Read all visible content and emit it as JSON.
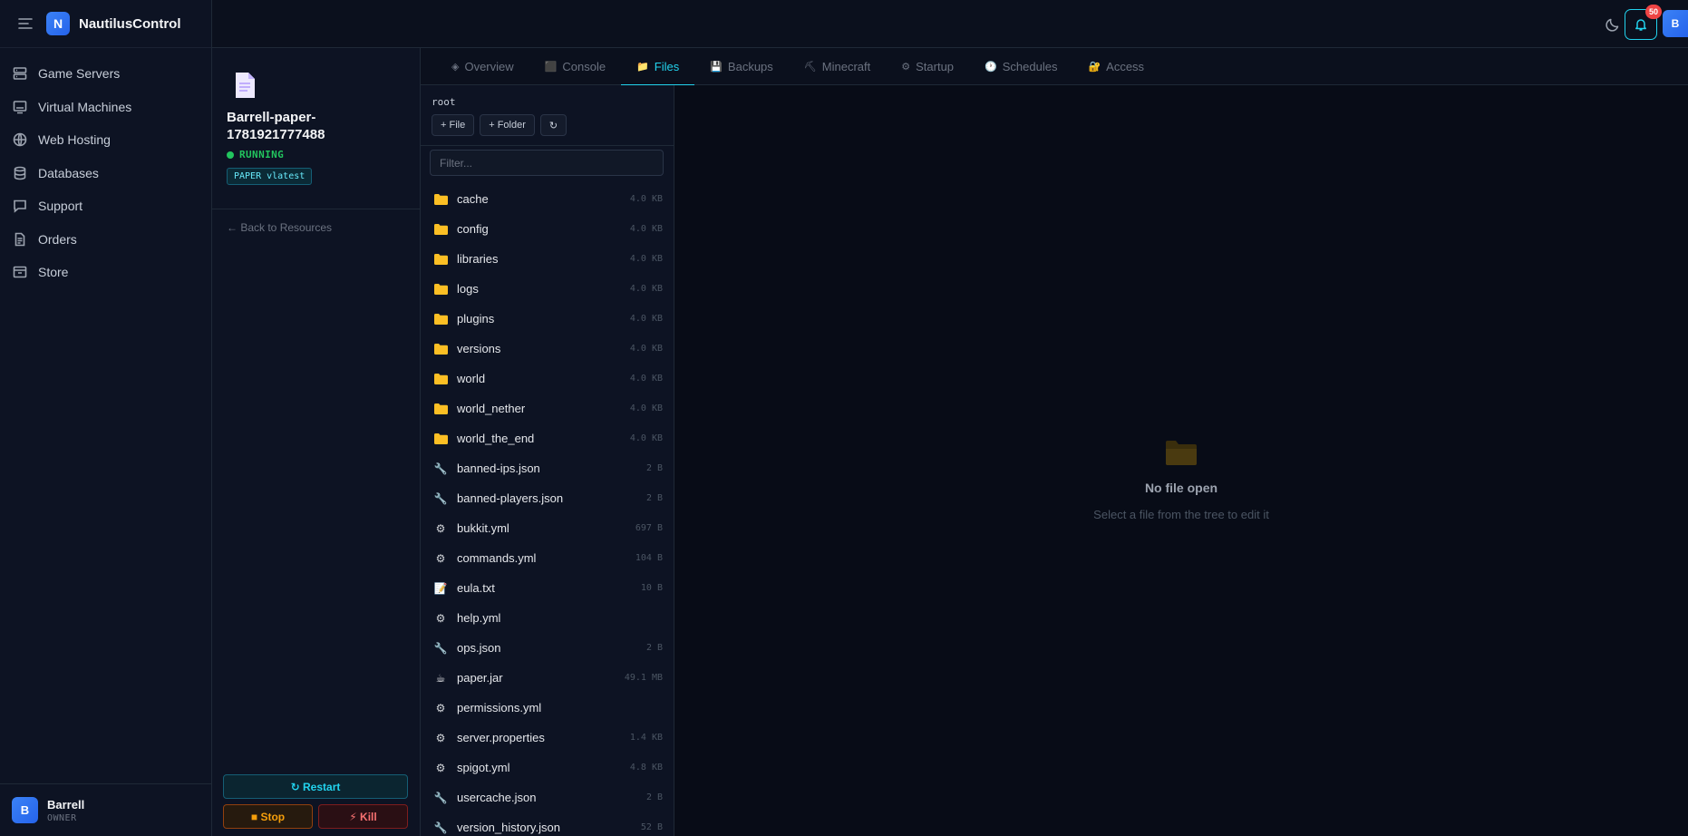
{
  "app": {
    "name": "NautilusControl",
    "logo_letter": "N"
  },
  "nav": [
    {
      "label": "Game Servers",
      "icon": "server-icon"
    },
    {
      "label": "Virtual Machines",
      "icon": "monitor-icon"
    },
    {
      "label": "Web Hosting",
      "icon": "globe-icon"
    },
    {
      "label": "Databases",
      "icon": "database-icon"
    },
    {
      "label": "Support",
      "icon": "chat-icon"
    },
    {
      "label": "Orders",
      "icon": "document-icon"
    },
    {
      "label": "Store",
      "icon": "store-icon"
    }
  ],
  "user": {
    "initial": "B",
    "name": "Barrell",
    "role": "OWNER"
  },
  "topbar": {
    "notification_count": "50",
    "avatar_initial": "B"
  },
  "server": {
    "name": "Barrell-paper-1781921777488",
    "status": "RUNNING",
    "version_badge": "PAPER vlatest",
    "back_link": "← Back to Resources",
    "restart_label": "↻ Restart",
    "stop_label": "■ Stop",
    "kill_label": "⚡ Kill"
  },
  "tabs": [
    {
      "label": "Overview",
      "icon": "◈",
      "active": false
    },
    {
      "label": "Console",
      "icon": "⬛",
      "active": false
    },
    {
      "label": "Files",
      "icon": "📁",
      "active": true
    },
    {
      "label": "Backups",
      "icon": "💾",
      "active": false
    },
    {
      "label": "Minecraft",
      "icon": "⛏",
      "active": false
    },
    {
      "label": "Startup",
      "icon": "⚙",
      "active": false
    },
    {
      "label": "Schedules",
      "icon": "🕐",
      "active": false
    },
    {
      "label": "Access",
      "icon": "🔐",
      "active": false
    }
  ],
  "files": {
    "path": "root",
    "new_file_label": "+ File",
    "new_folder_label": "+ Folder",
    "refresh_label": "↻",
    "filter_placeholder": "Filter...",
    "items": [
      {
        "name": "cache",
        "size": "4.0 KB",
        "type": "folder"
      },
      {
        "name": "config",
        "size": "4.0 KB",
        "type": "folder"
      },
      {
        "name": "libraries",
        "size": "4.0 KB",
        "type": "folder"
      },
      {
        "name": "logs",
        "size": "4.0 KB",
        "type": "folder"
      },
      {
        "name": "plugins",
        "size": "4.0 KB",
        "type": "folder"
      },
      {
        "name": "versions",
        "size": "4.0 KB",
        "type": "folder"
      },
      {
        "name": "world",
        "size": "4.0 KB",
        "type": "folder"
      },
      {
        "name": "world_nether",
        "size": "4.0 KB",
        "type": "folder"
      },
      {
        "name": "world_the_end",
        "size": "4.0 KB",
        "type": "folder"
      },
      {
        "name": "banned-ips.json",
        "size": "2 B",
        "type": "json"
      },
      {
        "name": "banned-players.json",
        "size": "2 B",
        "type": "json"
      },
      {
        "name": "bukkit.yml",
        "size": "697 B",
        "type": "config"
      },
      {
        "name": "commands.yml",
        "size": "104 B",
        "type": "config"
      },
      {
        "name": "eula.txt",
        "size": "10 B",
        "type": "text"
      },
      {
        "name": "help.yml",
        "size": "",
        "type": "config"
      },
      {
        "name": "ops.json",
        "size": "2 B",
        "type": "json"
      },
      {
        "name": "paper.jar",
        "size": "49.1 MB",
        "type": "jar"
      },
      {
        "name": "permissions.yml",
        "size": "",
        "type": "config"
      },
      {
        "name": "server.properties",
        "size": "1.4 KB",
        "type": "config"
      },
      {
        "name": "spigot.yml",
        "size": "4.8 KB",
        "type": "config"
      },
      {
        "name": "usercache.json",
        "size": "2 B",
        "type": "json"
      },
      {
        "name": "version_history.json",
        "size": "52 B",
        "type": "json"
      }
    ]
  },
  "editor": {
    "empty_title": "No file open",
    "empty_subtitle": "Select a file from the tree to edit it"
  },
  "colors": {
    "accent": "#22d3ee",
    "running": "#22c55e",
    "folder": "#fbbf24",
    "danger": "#ef4444",
    "warning": "#f59e0b"
  }
}
